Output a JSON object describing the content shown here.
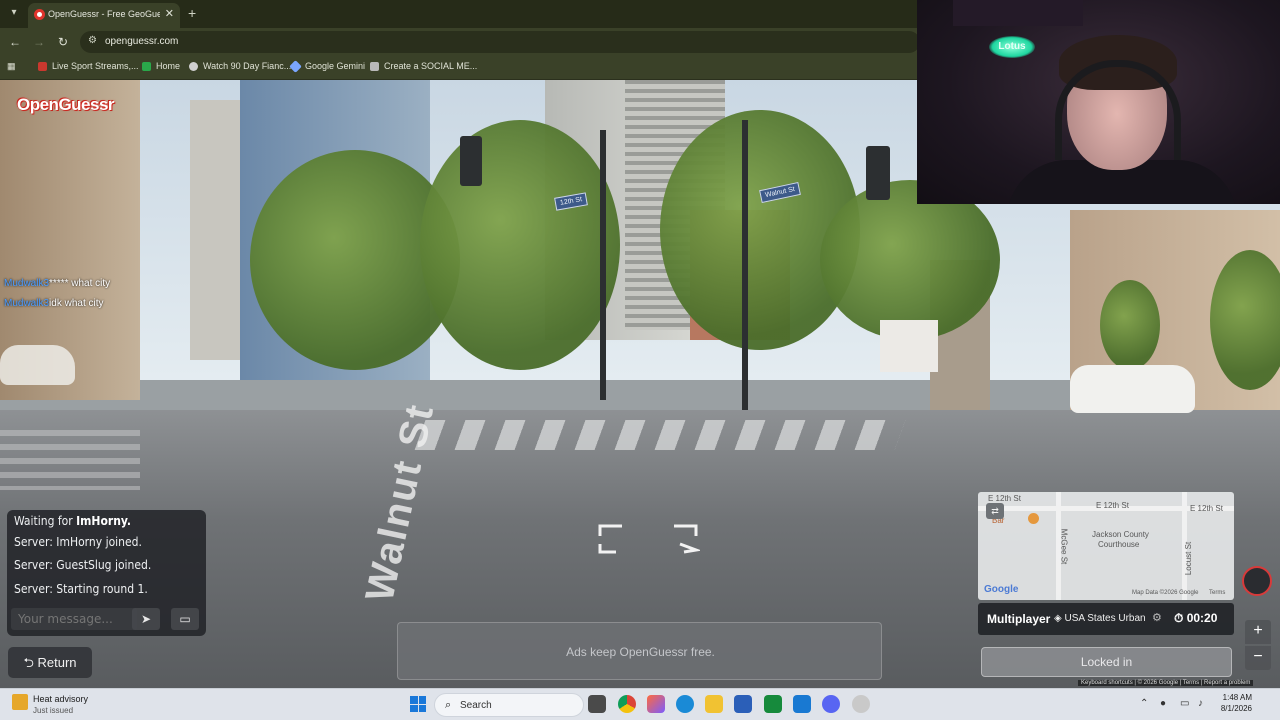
{
  "browser": {
    "tab_title": "OpenGuessr - Free GeoGuessr",
    "url": "openguessr.com",
    "bookmarks": [
      "Live Sport Streams,...",
      "Home",
      "Watch 90 Day Fianc...",
      "Google Gemini",
      "Create a SOCIAL ME..."
    ]
  },
  "game": {
    "logo": "OpenGuessr",
    "overlay_chat": [
      {
        "user": "Mudwalk3",
        "text": "***** what city"
      },
      {
        "user": "Mudwalk3",
        "text": "idk what city"
      }
    ],
    "street_label": "Walnut St",
    "chat": {
      "waiting_prefix": "Waiting for",
      "waiting_user": "ImHorny.",
      "messages": [
        "Server: ImHorny joined.",
        "Server: GuestSlug joined.",
        "Server: Starting round 1."
      ],
      "input_placeholder": "Your message..."
    },
    "return_label": "Return",
    "ad_text": "Ads keep OpenGuessr free.",
    "minimap": {
      "streets": [
        "E 12th St",
        "E 12th St",
        "E 12th St",
        "McGee St",
        "Locust St"
      ],
      "poi_jackson": "Jackson County",
      "poi_courthouse": "Courthouse",
      "poi_bar": "Bar",
      "attribution": "Map Data ©2026 Google",
      "terms": "Terms",
      "google": "Google"
    },
    "mode": "Multiplayer",
    "map_name": "USA States Urban",
    "timer": "00:20",
    "locked_label": "Locked in",
    "footer": "Keyboard shortcuts | © 2026 Google | Terms | Report a problem"
  },
  "webcam": {
    "sign_text": "Lotus"
  },
  "taskbar": {
    "weather_title": "Heat advisory",
    "weather_sub": "Just issued",
    "search_label": "Search",
    "time": "1:48 AM",
    "date": "8/1/2026"
  },
  "colors": {
    "accent_red": "#e0342c",
    "chat_user": "#4a9cff",
    "windows_blue": "#1a78d9"
  }
}
